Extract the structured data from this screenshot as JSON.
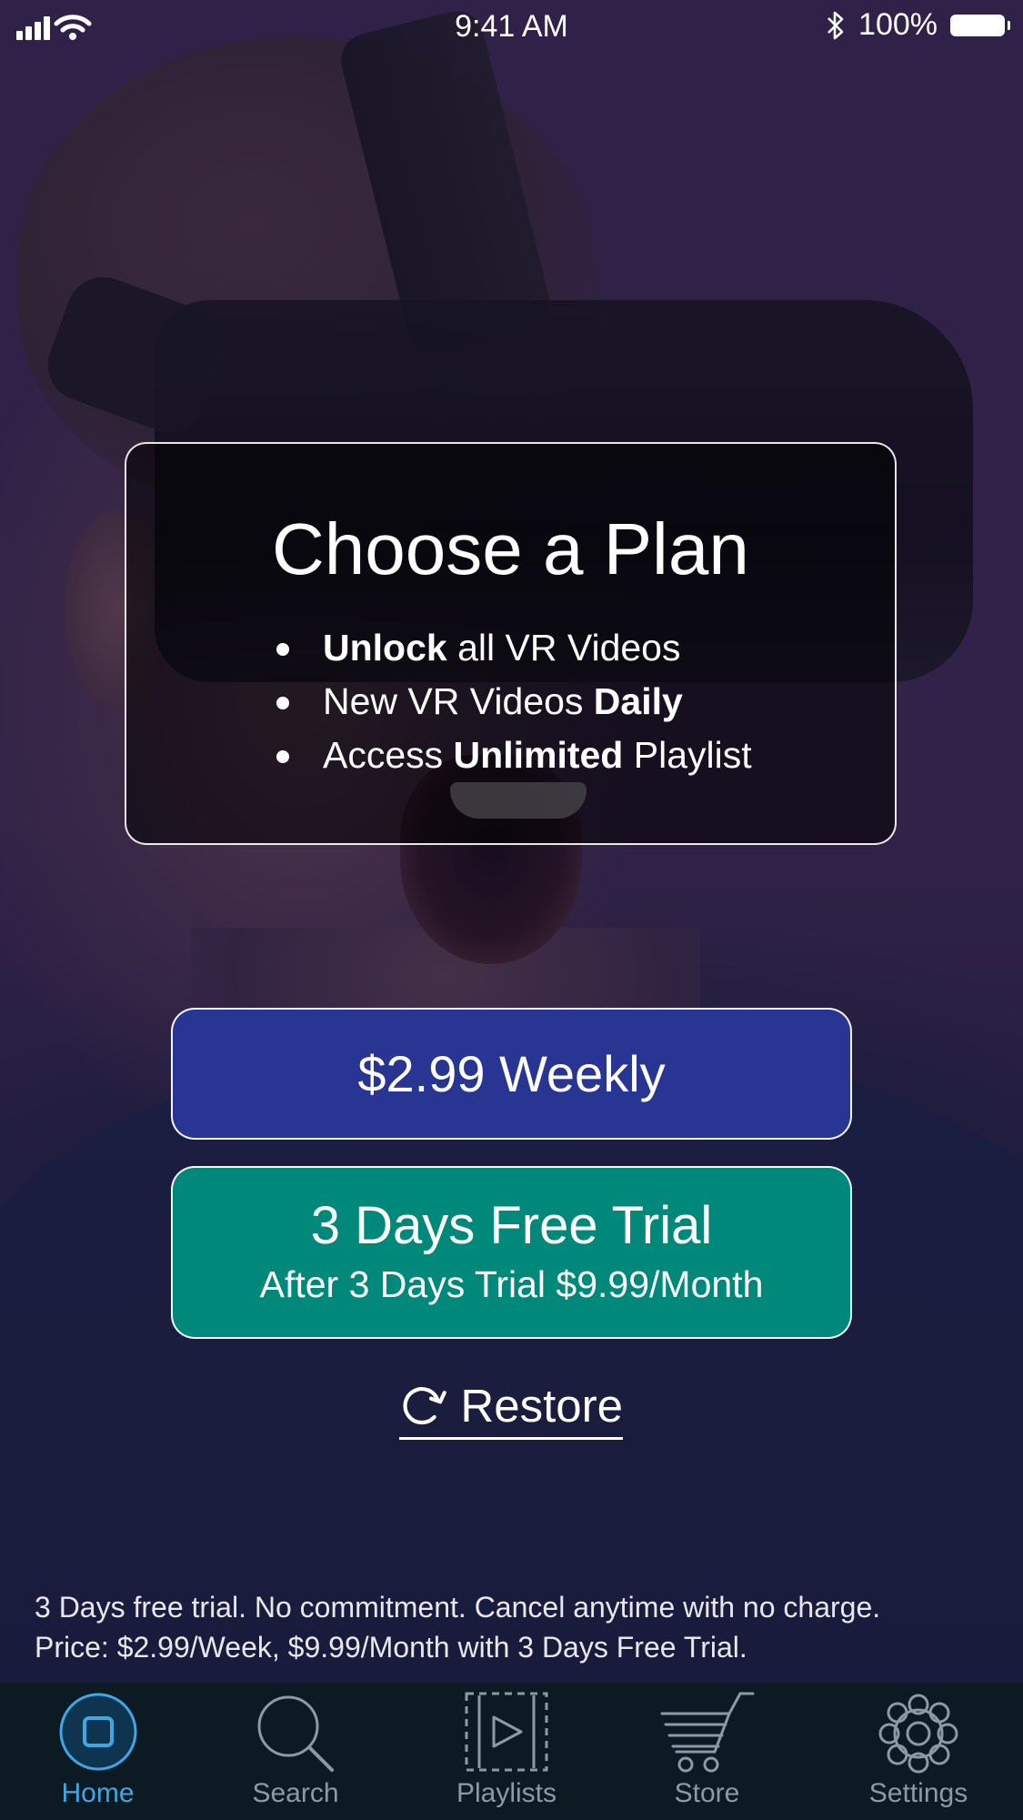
{
  "status_bar": {
    "time": "9:41 AM",
    "battery": "100%"
  },
  "plan": {
    "title": "Choose a Plan",
    "bullets": [
      {
        "bold": "Unlock",
        "text": " all VR Videos"
      },
      {
        "pre": "New VR Videos ",
        "bold": "Daily"
      },
      {
        "pre": "Access ",
        "bold": "Unlimited",
        "text": " Playlist"
      }
    ]
  },
  "buttons": {
    "weekly": "$2.99 Weekly",
    "trial_title": "3 Days Free Trial",
    "trial_sub": "After 3 Days Trial $9.99/Month",
    "restore": "Restore"
  },
  "disclaimer": {
    "line1": "3 Days free trial. No commitment. Cancel anytime with no charge.",
    "line2": "Price: $2.99/Week, $9.99/Month with 3 Days Free Trial."
  },
  "tabs": [
    {
      "label": "Home",
      "icon": "home-icon",
      "active": true
    },
    {
      "label": "Search",
      "icon": "search-icon"
    },
    {
      "label": "Playlists",
      "icon": "playlists-icon"
    },
    {
      "label": "Store",
      "icon": "cart-icon"
    },
    {
      "label": "Settings",
      "icon": "gear-icon"
    }
  ],
  "colors": {
    "weekly_button": "#283593",
    "trial_button": "#00897b",
    "tab_active": "#3fa8e4",
    "tab_inactive": "#8b9aa6",
    "tab_bar_bg": "#0c1a24"
  }
}
